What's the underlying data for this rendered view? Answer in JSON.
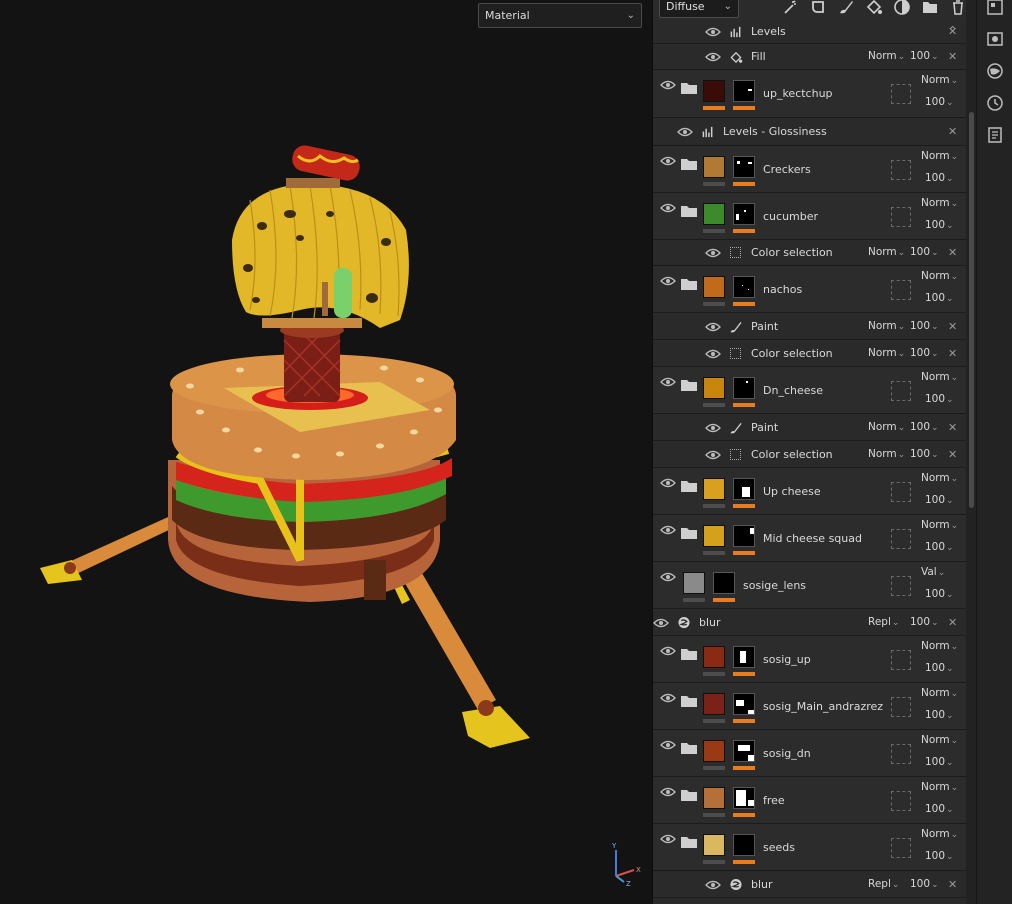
{
  "viewport": {
    "material_dropdown": "Material"
  },
  "toolbar": {
    "channel": "Diffuse"
  },
  "layers": [
    {
      "type": "sub",
      "icon": "levels",
      "name": "Levels",
      "blend": "",
      "opacity": ""
    },
    {
      "type": "sub",
      "icon": "fill",
      "name": "Fill",
      "blend": "Norm",
      "opacity": "100"
    },
    {
      "type": "folder",
      "name": "up_kectchup",
      "blend": "Norm",
      "opacity": "100",
      "thumb": "#3a0c08"
    },
    {
      "type": "sub",
      "icon": "levels",
      "name": "Levels - Glossiness",
      "blend": "",
      "opacity": ""
    },
    {
      "type": "folder",
      "name": "Creckers",
      "blend": "Norm",
      "opacity": "100",
      "thumb": "#b07a35"
    },
    {
      "type": "folder",
      "name": "cucumber",
      "blend": "Norm",
      "opacity": "100",
      "thumb": "#3d8a2c"
    },
    {
      "type": "sub",
      "icon": "selection",
      "name": "Color selection",
      "blend": "Norm",
      "opacity": "100"
    },
    {
      "type": "folder",
      "name": "nachos",
      "blend": "Norm",
      "opacity": "100",
      "thumb": "#c06a1a"
    },
    {
      "type": "sub",
      "icon": "paint",
      "name": "Paint",
      "blend": "Norm",
      "opacity": "100"
    },
    {
      "type": "sub",
      "icon": "selection",
      "name": "Color selection",
      "blend": "Norm",
      "opacity": "100"
    },
    {
      "type": "folder",
      "name": "Dn_cheese",
      "blend": "Norm",
      "opacity": "100",
      "thumb": "#c9860f"
    },
    {
      "type": "sub",
      "icon": "paint",
      "name": "Paint",
      "blend": "Norm",
      "opacity": "100"
    },
    {
      "type": "sub",
      "icon": "selection",
      "name": "Color selection",
      "blend": "Norm",
      "opacity": "100"
    },
    {
      "type": "folder",
      "name": "Up cheese",
      "blend": "Norm",
      "opacity": "100",
      "thumb": "#d9a020"
    },
    {
      "type": "folder",
      "name": "Mid cheese squad",
      "blend": "Norm",
      "opacity": "100",
      "thumb": "#d4a11c"
    },
    {
      "type": "layer",
      "name": "sosige_lens",
      "blend": "Val",
      "opacity": "100",
      "thumb": "#8a8a8a"
    },
    {
      "type": "sub",
      "icon": "filter",
      "name": "blur",
      "blend": "Repl",
      "opacity": "100"
    },
    {
      "type": "folder",
      "name": "sosig_up",
      "blend": "Norm",
      "opacity": "100",
      "thumb": "#8a2a14"
    },
    {
      "type": "folder",
      "name": "sosig_Main_andrazrez",
      "blend": "Norm",
      "opacity": "100",
      "thumb": "#7a2218"
    },
    {
      "type": "folder",
      "name": "sosig_dn",
      "blend": "Norm",
      "opacity": "100",
      "thumb": "#9a3a14"
    },
    {
      "type": "folder",
      "name": "free",
      "blend": "Norm",
      "opacity": "100",
      "thumb": "#b5703a"
    },
    {
      "type": "folder",
      "name": "seeds",
      "blend": "Norm",
      "opacity": "100",
      "thumb": "#d9b860"
    },
    {
      "type": "sub",
      "icon": "filter",
      "name": "blur",
      "blend": "Repl",
      "opacity": "100"
    }
  ],
  "gizmo": {
    "y": "Y",
    "x": "X",
    "z": "Z"
  }
}
